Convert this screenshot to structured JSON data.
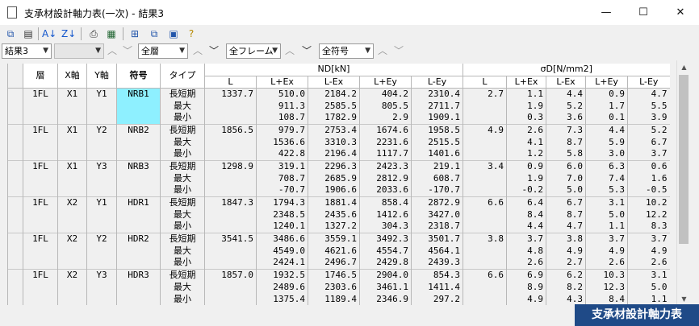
{
  "window": {
    "title": "支承材設計軸力表(一次) - 結果3",
    "minimize": "—",
    "maximize": "☐",
    "close": "✕"
  },
  "toolbar": {
    "icons": [
      "copy-icon",
      "export-icon",
      "sort-asc-icon",
      "sort-desc-icon",
      "print-icon",
      "print-preview-icon",
      "add-window-icon",
      "tile-window-icon",
      "settings-icon",
      "help-icon"
    ]
  },
  "filters": {
    "result": "結果3",
    "empty_combo": "",
    "layer": "全層",
    "frame": "全フレーム",
    "symbol": "全符号"
  },
  "table": {
    "headers": {
      "layer": "層",
      "x": "X軸",
      "y": "Y軸",
      "symbol": "符号",
      "type": "タイプ",
      "nd": "ND[kN]",
      "sd": "σD[N/mm2]"
    },
    "subheaders": [
      "L",
      "L+Ex",
      "L-Ex",
      "L+Ey",
      "L-Ey",
      "L",
      "L+Ex",
      "L-Ex",
      "L+Ey",
      "L-Ey"
    ],
    "groups": [
      {
        "layer": "1FL",
        "x": "X1",
        "y": "Y1",
        "symbol": "NRB1",
        "nd_L": "1337.7",
        "sd_L": "2.7",
        "rows": [
          {
            "type": "長短期",
            "nd": [
              "510.0",
              "2184.2",
              "404.2",
              "2310.4"
            ],
            "sd": [
              "1.1",
              "4.4",
              "0.9",
              "4.7"
            ]
          },
          {
            "type": "最大",
            "nd": [
              "911.3",
              "2585.5",
              "805.5",
              "2711.7"
            ],
            "sd": [
              "1.9",
              "5.2",
              "1.7",
              "5.5"
            ]
          },
          {
            "type": "最小",
            "nd": [
              "108.7",
              "1782.9",
              "2.9",
              "1909.1"
            ],
            "sd": [
              "0.3",
              "3.6",
              "0.1",
              "3.9"
            ]
          }
        ]
      },
      {
        "layer": "1FL",
        "x": "X1",
        "y": "Y2",
        "symbol": "NRB2",
        "nd_L": "1856.5",
        "sd_L": "4.9",
        "rows": [
          {
            "type": "長短期",
            "nd": [
              "979.7",
              "2753.4",
              "1674.6",
              "1958.5"
            ],
            "sd": [
              "2.6",
              "7.3",
              "4.4",
              "5.2"
            ]
          },
          {
            "type": "最大",
            "nd": [
              "1536.6",
              "3310.3",
              "2231.6",
              "2515.5"
            ],
            "sd": [
              "4.1",
              "8.7",
              "5.9",
              "6.7"
            ]
          },
          {
            "type": "最小",
            "nd": [
              "422.8",
              "2196.4",
              "1117.7",
              "1401.6"
            ],
            "sd": [
              "1.2",
              "5.8",
              "3.0",
              "3.7"
            ]
          }
        ]
      },
      {
        "layer": "1FL",
        "x": "X1",
        "y": "Y3",
        "symbol": "NRB3",
        "nd_L": "1298.9",
        "sd_L": "3.4",
        "rows": [
          {
            "type": "長短期",
            "nd": [
              "319.1",
              "2296.3",
              "2423.3",
              "219.1"
            ],
            "sd": [
              "0.9",
              "6.0",
              "6.3",
              "0.6"
            ]
          },
          {
            "type": "最大",
            "nd": [
              "708.7",
              "2685.9",
              "2812.9",
              "608.7"
            ],
            "sd": [
              "1.9",
              "7.0",
              "7.4",
              "1.6"
            ]
          },
          {
            "type": "最小",
            "nd": [
              "-70.7",
              "1906.6",
              "2033.6",
              "-170.7"
            ],
            "sd": [
              "-0.2",
              "5.0",
              "5.3",
              "-0.5"
            ]
          }
        ]
      },
      {
        "layer": "1FL",
        "x": "X2",
        "y": "Y1",
        "symbol": "HDR1",
        "nd_L": "1847.3",
        "sd_L": "6.6",
        "rows": [
          {
            "type": "長短期",
            "nd": [
              "1794.3",
              "1881.4",
              "858.4",
              "2872.9"
            ],
            "sd": [
              "6.4",
              "6.7",
              "3.1",
              "10.2"
            ]
          },
          {
            "type": "最大",
            "nd": [
              "2348.5",
              "2435.6",
              "1412.6",
              "3427.0"
            ],
            "sd": [
              "8.4",
              "8.7",
              "5.0",
              "12.2"
            ]
          },
          {
            "type": "最小",
            "nd": [
              "1240.1",
              "1327.2",
              "304.3",
              "2318.7"
            ],
            "sd": [
              "4.4",
              "4.7",
              "1.1",
              "8.3"
            ]
          }
        ]
      },
      {
        "layer": "1FL",
        "x": "X2",
        "y": "Y2",
        "symbol": "HDR2",
        "nd_L": "3541.5",
        "sd_L": "3.8",
        "rows": [
          {
            "type": "長短期",
            "nd": [
              "3486.6",
              "3559.1",
              "3492.3",
              "3501.7"
            ],
            "sd": [
              "3.7",
              "3.8",
              "3.7",
              "3.7"
            ]
          },
          {
            "type": "最大",
            "nd": [
              "4549.0",
              "4621.6",
              "4554.7",
              "4564.1"
            ],
            "sd": [
              "4.8",
              "4.9",
              "4.9",
              "4.9"
            ]
          },
          {
            "type": "最小",
            "nd": [
              "2424.1",
              "2496.7",
              "2429.8",
              "2439.3"
            ],
            "sd": [
              "2.6",
              "2.7",
              "2.6",
              "2.6"
            ]
          }
        ]
      },
      {
        "layer": "1FL",
        "x": "X2",
        "y": "Y3",
        "symbol": "HDR3",
        "nd_L": "1857.0",
        "sd_L": "6.6",
        "rows": [
          {
            "type": "長短期",
            "nd": [
              "1932.5",
              "1746.5",
              "2904.0",
              "854.3"
            ],
            "sd": [
              "6.9",
              "6.2",
              "10.3",
              "3.1"
            ]
          },
          {
            "type": "最大",
            "nd": [
              "2489.6",
              "2303.6",
              "3461.1",
              "1411.4"
            ],
            "sd": [
              "8.9",
              "8.2",
              "12.3",
              "5.0"
            ]
          },
          {
            "type": "最小",
            "nd": [
              "1375.4",
              "1189.4",
              "2346.9",
              "297.2"
            ],
            "sd": [
              "4.9",
              "4.3",
              "8.4",
              "1.1"
            ]
          }
        ]
      }
    ]
  },
  "badge": "支承材設計軸力表"
}
